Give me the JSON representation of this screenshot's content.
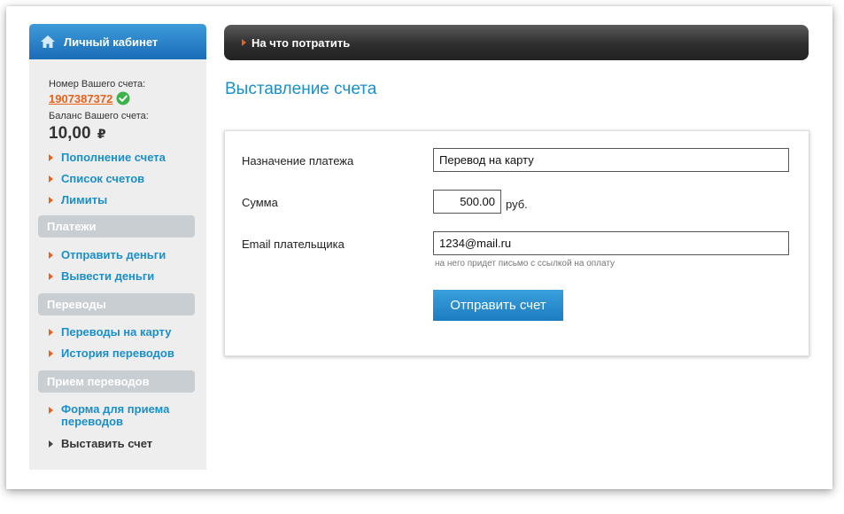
{
  "sidebar": {
    "header": "Личный кабинет",
    "account_label": "Номер Вашего счета:",
    "account_number": "1907387372",
    "balance_label": "Баланс Вашего счета:",
    "balance_value": "10,00",
    "currency_symbol": "₽",
    "account_links": [
      "Пополнение счета",
      "Список счетов",
      "Лимиты"
    ],
    "sections": [
      {
        "title": "Платежи",
        "links": [
          "Отправить деньги",
          "Вывести деньги"
        ]
      },
      {
        "title": "Переводы",
        "links": [
          "Переводы на карту",
          "История переводов"
        ]
      },
      {
        "title": "Прием переводов",
        "links": [
          "Форма для приема переводов",
          "Выставить счет"
        ]
      }
    ]
  },
  "topbar": {
    "title": "На что потратить"
  },
  "page": {
    "title": "Выставление счета"
  },
  "form": {
    "purpose_label": "Назначение платежа",
    "purpose_value": "Перевод на карту",
    "amount_label": "Сумма",
    "amount_value": "500.00",
    "amount_unit": "руб.",
    "email_label": "Email плательщика",
    "email_value": "1234@mail.ru",
    "email_hint": "на него придет письмо с ссылкой на оплату",
    "submit_label": "Отправить счет"
  },
  "colors": {
    "accent": "#1a8fc9",
    "arrow": "#e8621a",
    "account_number": "#e8621a",
    "section_bg": "#c8ced2"
  },
  "icons": {
    "header": "home-icon",
    "account_status": "check-circle-icon",
    "list_marker": "triangle-right-icon"
  }
}
